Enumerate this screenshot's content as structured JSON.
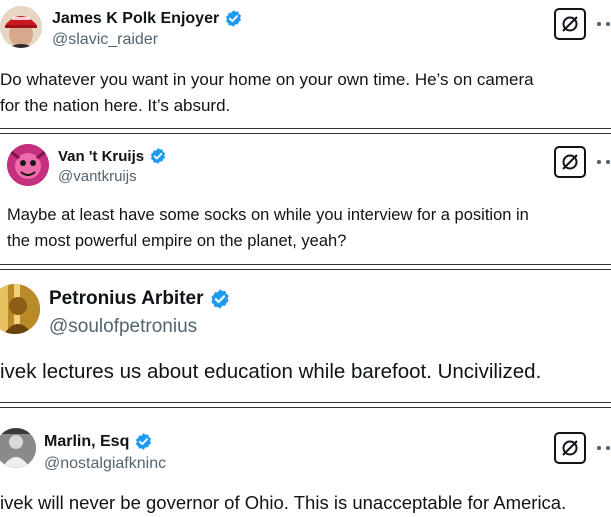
{
  "tweets": [
    {
      "name": "James K Polk Enjoyer",
      "handle": "@slavic_raider",
      "lines": [
        "Do whatever you want in your home on your own time. He’s on camera",
        "for the nation here. It’s absurd."
      ],
      "verified": true,
      "has_grok_button": true,
      "has_more_menu": true,
      "avatar_icon": "avatar-red-cap-icon"
    },
    {
      "name": "Van 't Kruijs",
      "handle": "@vantkruijs",
      "lines": [
        "Maybe at least have some socks on while you interview for a position in",
        "the most powerful empire on the planet, yeah?"
      ],
      "verified": true,
      "has_grok_button": true,
      "has_more_menu": true,
      "avatar_icon": "avatar-pink-face-icon"
    },
    {
      "name": "Petronius Arbiter",
      "handle": "@soulofpetronius",
      "lines": [
        "ivek lectures us about education while barefoot. Uncivilized."
      ],
      "verified": true,
      "has_grok_button": false,
      "has_more_menu": false,
      "avatar_icon": "avatar-golden-statue-icon"
    },
    {
      "name": "Marlin, Esq",
      "handle": "@nostalgiafkninc",
      "lines": [
        "ivek will never be governor of Ohio. This is unacceptable for America."
      ],
      "verified": true,
      "has_grok_button": true,
      "has_more_menu": true,
      "avatar_icon": "avatar-bw-photo-icon"
    }
  ],
  "colors": {
    "verified_blue": "#1d9bf0",
    "handle_gray": "#536471",
    "text": "#0f1419",
    "divider": "#2f3336"
  }
}
